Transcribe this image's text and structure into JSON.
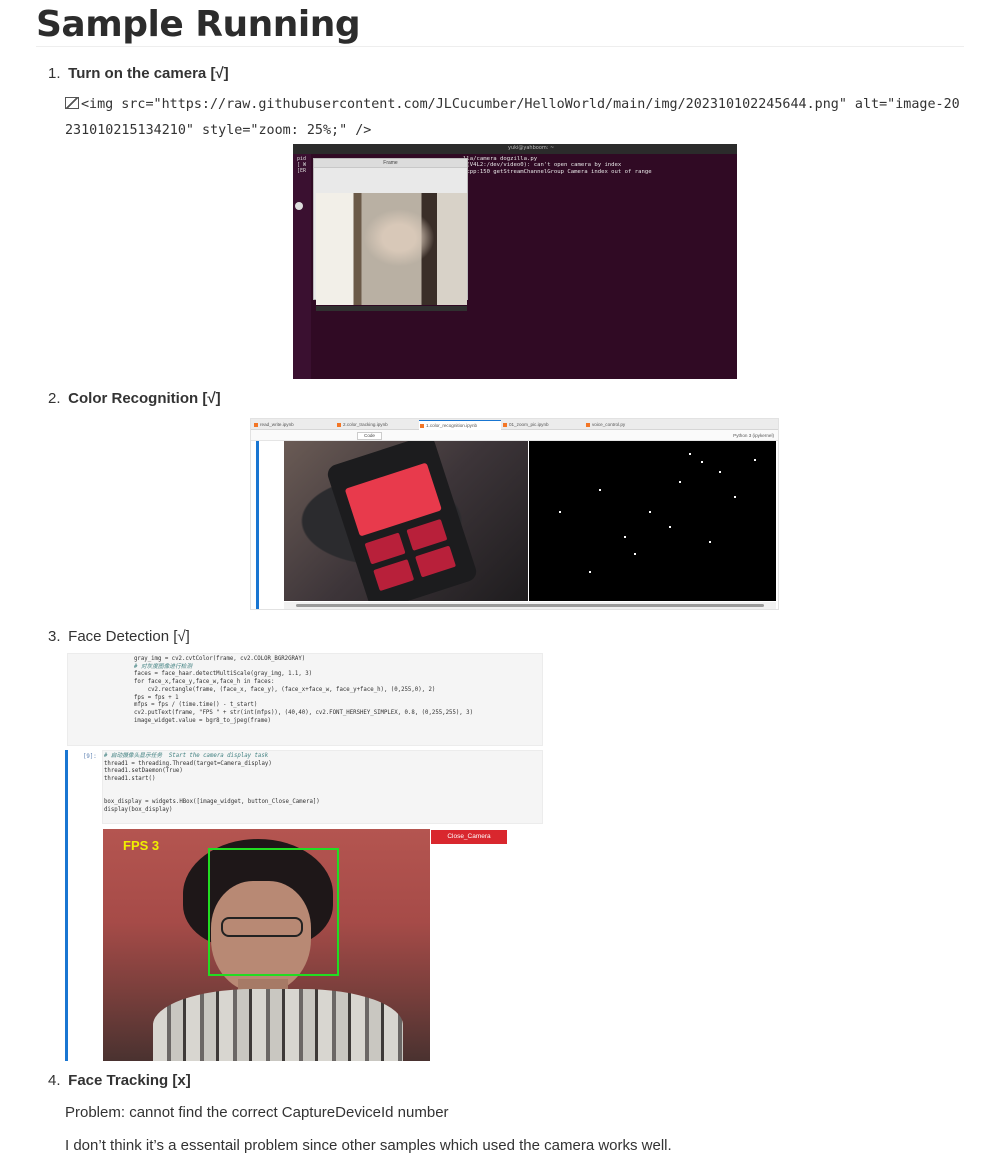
{
  "title": "Sample Running",
  "items": [
    {
      "num": "1.",
      "text": "Turn on the camera",
      "mark": "[√]"
    },
    {
      "num": "2.",
      "text": "Color Recognition",
      "mark": "[√]"
    },
    {
      "num": "3.",
      "text": "Face Detection",
      "mark": "[√]"
    },
    {
      "num": "4.",
      "text": "Face Tracking",
      "mark": "[x]"
    }
  ],
  "broken_image_line": "<img src=\"https://raw.githubusercontent.com/JLCucumber/HelloWorld/main/img/202310102245644.png\" alt=\"image-20231010215134210\" style=\"zoom: 25%;\" />",
  "paragraphs": [
    "Problem: cannot find the correct CaptureDeviceId number",
    "I don’t think it’s a essentail problem since other samples which used the camera works well."
  ],
  "shot1": {
    "window_title": "yuki@yahboom: ~",
    "cam_window_title": "Frame",
    "terminal_lines": [
      "lla/camera dogzilla.py",
      "0(V4L2:/dev/video0): can't open camera by index",
      ".cpp:150 getStreamChannelGroup Camera index out of range"
    ],
    "left_lines": [
      "pid",
      "[ W",
      "[ER"
    ]
  },
  "shot2": {
    "tabs": [
      "read_write.ipynb",
      "2.color_tracking.ipynb",
      "1.color_recognition.ipynb",
      "01_zoom_pic.ipynb",
      "voice_control.py"
    ],
    "mode": "Code",
    "kernel": "Python 3 (ipykernel)"
  },
  "shot3": {
    "code1": [
      "gray_img = cv2.cvtColor(frame, cv2.COLOR_BGR2GRAY)",
      "# 对灰度图像进行检测",
      "faces = face_haar.detectMultiScale(gray_img, 1.1, 3)",
      "for face_x,face_y,face_w,face_h in faces:",
      "    cv2.rectangle(frame, (face_x, face_y), (face_x+face_w, face_y+face_h), (0,255,0), 2)",
      "fps = fps + 1",
      "mfps = fps / (time.time() - t_start)",
      "cv2.putText(frame, \"FPS \" + str(int(mfps)), (40,40), cv2.FONT_HERSHEY_SIMPLEX, 0.8, (0,255,255), 3)",
      "image_widget.value = bgr8_to_jpeg(frame)"
    ],
    "prompt": "[9]:",
    "code2": [
      "# 启动摄像头显示任务  Start the camera display task",
      "thread1 = threading.Thread(target=Camera_display)",
      "thread1.setDaemon(True)",
      "thread1.start()",
      "",
      "",
      "box_display = widgets.HBox([image_widget, button_Close_Camera])",
      "display(box_display)"
    ],
    "fps_label": "FPS 3",
    "button_label": "Close_Camera"
  }
}
